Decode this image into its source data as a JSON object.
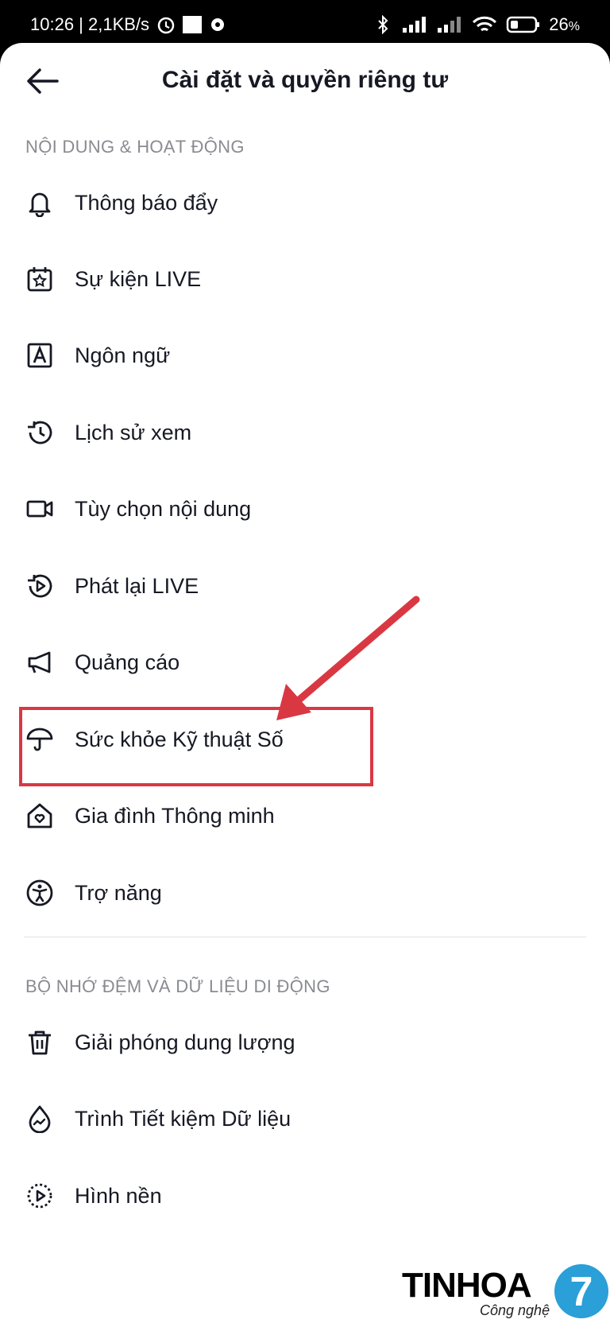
{
  "status_bar": {
    "time_speed": "10:26 | 2,1KB/s",
    "battery": "26",
    "battery_unit": "%"
  },
  "header": {
    "title": "Cài đặt và quyền riêng tư"
  },
  "sections": [
    {
      "title": "NỘI DUNG & HOẠT ĐỘNG",
      "items": [
        {
          "label": "Thông báo đẩy",
          "icon": "bell-icon"
        },
        {
          "label": "Sự kiện LIVE",
          "icon": "calendar-star-icon"
        },
        {
          "label": "Ngôn ngữ",
          "icon": "language-icon"
        },
        {
          "label": "Lịch sử xem",
          "icon": "history-icon"
        },
        {
          "label": "Tùy chọn nội dung",
          "icon": "video-camera-icon"
        },
        {
          "label": "Phát lại LIVE",
          "icon": "replay-icon"
        },
        {
          "label": "Quảng cáo",
          "icon": "megaphone-icon"
        },
        {
          "label": "Sức khỏe Kỹ thuật Số",
          "icon": "umbrella-icon"
        },
        {
          "label": "Gia đình Thông minh",
          "icon": "home-heart-icon"
        },
        {
          "label": "Trợ năng",
          "icon": "accessibility-icon"
        }
      ]
    },
    {
      "title": "BỘ NHỚ ĐỆM VÀ DỮ LIỆU DI ĐỘNG",
      "items": [
        {
          "label": "Giải phóng dung lượng",
          "icon": "trash-icon"
        },
        {
          "label": "Trình Tiết kiệm Dữ liệu",
          "icon": "data-saver-icon"
        },
        {
          "label": "Hình nền",
          "icon": "wallpaper-icon"
        }
      ]
    }
  ],
  "watermark": {
    "brand": "TINHOA",
    "sub": "Công nghệ",
    "mark": "7"
  },
  "colors": {
    "highlight": "#d93843",
    "text": "#161823",
    "section": "#8a8b91"
  }
}
